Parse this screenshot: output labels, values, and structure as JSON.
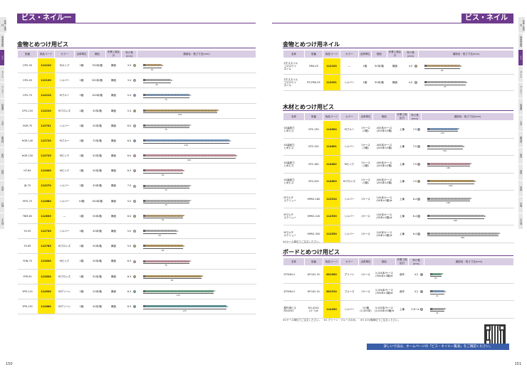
{
  "page": {
    "title_left": "ビス・ネイル一覧",
    "title_right": "ビス・ネイル一覧",
    "page_left": "150",
    "page_right": "151"
  },
  "side_tabs_left": [
    "合板・集成材",
    "構造用金物",
    "ビス",
    "ネイル",
    "アンカー",
    "接着剤",
    "工具",
    "副資材",
    "床材",
    "建材",
    "住設",
    "外構",
    "その他"
  ],
  "side_tabs_right": [
    "合板・集成材",
    "構造用金物",
    "ビス",
    "ネイル",
    "アンカー",
    "接着剤",
    "工具",
    "副資材",
    "床材",
    "建材",
    "住設",
    "外構",
    "その他"
  ],
  "sec_metal_bis": {
    "title": "金物とめつけ用ビス",
    "headers": [
      "型番",
      "商品コード",
      "カラー",
      "出荷単位",
      "梱包",
      "作業工程区分",
      "呼び長(mm)",
      "頭部径・長さ寸法(mm)"
    ],
    "rows": [
      {
        "model": "CPG-30",
        "code": "112220",
        "color": "Mカンプ",
        "unit": "1箱",
        "pack": "700本/箱",
        "process": "構造",
        "len": "3.5",
        "dim": "30",
        "screw_color": "#c9a874"
      },
      {
        "model": "CPG-45",
        "code": "112190",
        "color": "シルバー",
        "unit": "1箱",
        "pack": "500本/箱",
        "process": "構造",
        "len": "3.4",
        "dim": "45",
        "screw_color": "#bbbbbb"
      },
      {
        "model": "CPG-75",
        "code": "112210",
        "color": "Mブルー",
        "unit": "1箱",
        "pack": "100本/箱",
        "process": "構造",
        "len": "5.4",
        "dim": "75",
        "screw_color": "#8aa6c8"
      },
      {
        "model": "CPG-120",
        "code": "112220",
        "color": "Mブロンズ",
        "unit": "1箱",
        "pack": "50本/箱",
        "process": "構造",
        "len": "5.4",
        "dim": "120",
        "screw_color": "#c2a05a"
      },
      {
        "model": "HGR-75",
        "code": "112701",
        "color": "シルバー",
        "unit": "1箱",
        "pack": "50本/箱",
        "process": "構造",
        "len": "6.0",
        "dim": "75",
        "screw_color": "#c0c0c0"
      },
      {
        "model": "HGR-140",
        "code": "112720",
        "color": "Mブルー",
        "unit": "1箱",
        "pack": "70本/箱",
        "process": "構造",
        "len": "6.0",
        "dim": "140",
        "screw_color": "#7fa3cf"
      },
      {
        "model": "HGR-150",
        "code": "112725",
        "color": "Mピンク",
        "unit": "1箱",
        "pack": "50本/箱",
        "process": "構造",
        "len": "6.0",
        "dim": "150",
        "screw_color": "#d59aa7"
      },
      {
        "model": "HT-65",
        "code": "112600",
        "color": "Mピンク",
        "unit": "1箱",
        "pack": "50本/箱",
        "process": "構造",
        "len": "6.3",
        "dim": "65",
        "screw_color": "#d59aa7"
      },
      {
        "model": "JB-75",
        "code": "112270",
        "color": "シルバー",
        "unit": "1箱",
        "pack": "30本/箱",
        "process": "構造",
        "len": "7.0",
        "dim": "75",
        "screw_color": "#c0c0c0"
      },
      {
        "model": "MTS-75",
        "code": "112680",
        "color": "シルバー",
        "unit": "10箱",
        "pack": "150本/箱",
        "process": "構造",
        "len": "5.0",
        "dim": "75",
        "screw_color": "#c0c0c0"
      },
      {
        "model": "TBM-65",
        "code": "112635",
        "color": "―",
        "unit": "1箱",
        "pack": "50本/箱",
        "process": "構造",
        "len": "6.0",
        "dim": "65",
        "screw_color": "#c9a874"
      },
      {
        "model": "YS-55",
        "code": "112750",
        "color": "シルバー",
        "unit": "1箱",
        "pack": "50本/箱",
        "process": "構造",
        "len": "5.0",
        "dim": "55",
        "screw_color": "#c0c0c0"
      },
      {
        "model": "YS-65",
        "code": "112785",
        "color": "Mブロンズ",
        "unit": "1箱",
        "pack": "50本/箱",
        "process": "構造",
        "len": "5.5",
        "dim": "65",
        "screw_color": "#c2a05a"
      },
      {
        "model": "YHN-75",
        "code": "112640",
        "color": "Mピンク",
        "unit": "1箱",
        "pack": "50本/箱",
        "process": "構造",
        "len": "6.3",
        "dim": "75",
        "screw_color": "#d59aa7"
      },
      {
        "model": "YPR-95",
        "code": "112630",
        "color": "Mブロンズ",
        "unit": "1箱",
        "pack": "50本/箱",
        "process": "構造",
        "len": "6.3",
        "dim": "95",
        "screw_color": "#c2a05a"
      },
      {
        "model": "YPR-115",
        "code": "112630",
        "color": "Mグリーン",
        "unit": "1箱",
        "pack": "20本/箱",
        "process": "構造",
        "len": "6.3",
        "dim": "115",
        "screw_color": "#6fb28f"
      },
      {
        "model": "YPR-135",
        "code": "112660",
        "color": "Mグリーン",
        "unit": "1箱",
        "pack": "40本/箱",
        "process": "構造",
        "len": "6.3",
        "dim": "135",
        "screw_color": "#5da3a6"
      }
    ]
  },
  "sec_metal_nail": {
    "title": "金物とめつけ用ネイル",
    "headers": [
      "名称",
      "型番",
      "商品コード",
      "カラー",
      "出荷単位",
      "梱包",
      "作業工程区分",
      "呼び長(mm)",
      "頭部径・長さ寸法(mm)"
    ],
    "rows": [
      {
        "name": "Zホスネイル\nゴスロクイ\nネイル",
        "model": "FBN-55",
        "code": "112103",
        "color": "―",
        "unit": "1箱",
        "pack": "50本/箱",
        "process": "構造",
        "len": "4.5",
        "dim": "65",
        "screw_color": "#c9a874"
      },
      {
        "name": "Zホスネイル\nゴスロクイ\nネイル",
        "model": "PZ-FRN-55",
        "code": "112091",
        "color": "シルバー",
        "unit": "1箱",
        "pack": "50本/箱",
        "process": "構造",
        "len": "4.5",
        "dim": "75",
        "screw_color": "#bbbbbb"
      }
    ]
  },
  "sec_wood_bis": {
    "title": "木材とめつけ用ビス",
    "headers": [
      "名称",
      "型番",
      "商品コード",
      "カラー",
      "出荷単位",
      "梱包",
      "作業工程区分",
      "呼び長(mm)",
      "頭部径・長さ寸法(mm)"
    ],
    "rows": [
      {
        "name": "SX高耐力\nとめビス",
        "model": "KTS-130",
        "code": "114600",
        "color": "Mブルー",
        "unit": "1ケース\n(2箱)",
        "pack": "400本/ケース\n(200本×2箱)",
        "process": "上棟",
        "len": "7.0",
        "dim": "130",
        "screw_color": "#7fa3cf"
      },
      {
        "name": "SX高耐力\nとめビス",
        "model": "KTS-150",
        "code": "114601",
        "color": "シルバー",
        "unit": "1ケース\n(2箱)",
        "pack": "400本/ケース\n(200本×2箱)",
        "process": "上棟",
        "len": "7.0",
        "dim": "150",
        "screw_color": "#bbbbbb"
      },
      {
        "name": "SX高耐力\nとめビス",
        "model": "KTS-180",
        "code": "114602",
        "color": "Mピンク",
        "unit": "1ケース\n(2箱)",
        "pack": "400本/ケース\n(200本×2箱)",
        "process": "上棟",
        "len": "7.0",
        "dim": "180",
        "screw_color": "#d59aa7"
      },
      {
        "name": "SX高耐力\nとめビス",
        "model": "KTS-200",
        "code": "114603",
        "color": "Mブロンズ",
        "unit": "1ケース\n(2箱)",
        "pack": "400本/ケース\n(200本×2箱)",
        "process": "上棟",
        "len": "7.0",
        "dim": "200",
        "screw_color": "#c2a05a"
      },
      {
        "name": "Mマルチ\nスクリュー",
        "model": "MPKS-180",
        "code": "112510",
        "color": "シルバー",
        "unit": "1ケース",
        "pack": "100本/ケース\n(50本×2箱)※",
        "process": "上棟",
        "len": "6.4",
        "dim": "180",
        "screw_color": "#bbbbbb"
      },
      {
        "name": "Mマルチ\nスクリュー",
        "model": "MPKS-240",
        "code": "112530",
        "color": "シルバー",
        "unit": "1ケース",
        "pack": "100本/ケース\n(50本×2箱)※",
        "process": "上棟",
        "len": "6.4",
        "dim": "240",
        "screw_color": "#bbbbbb"
      },
      {
        "name": "Mマルチ\nスクリュー",
        "model": "MPKS-300",
        "code": "112550",
        "color": "シルバー",
        "unit": "1ケース",
        "pack": "100本/ケース\n(50本×2箱)※",
        "process": "上棟",
        "len": "6.4",
        "dim": "300",
        "screw_color": "#bbbbbb"
      }
    ],
    "footnote": "※1ケース単位でご注文ください。"
  },
  "sec_board_bis": {
    "title": "ボードとめつけ用ビス",
    "headers": [
      "名称",
      "型番",
      "商品コード",
      "カラー",
      "出荷単位",
      "梱包",
      "作業工程区分",
      "呼び長(mm)",
      "頭部径・長さ寸法(mm)"
    ],
    "rows": [
      {
        "name": "DTSHN-2",
        "model": "KFG42-32",
        "code": "801500",
        "color": "グリーン",
        "unit": "1ケース",
        "pack": "2,000本/ケース\n(500本×4箱)※",
        "process": "造作",
        "len": "4.2",
        "dim": "32",
        "screw_color": "#6fb28f"
      },
      {
        "name": "DTSHN-2",
        "model": "KFG42-41",
        "code": "801510",
        "color": "ブルーズ",
        "unit": "1ケース",
        "pack": "2,000本/ケース\n(500本×4箱)※",
        "process": "造作",
        "len": "4.2",
        "dim": "41",
        "screw_color": "#7fa3cf"
      },
      {
        "name": "屋外用ビス\nKG4041",
        "model": "KG-4041\n(ﾐﾄﾞﾘ)※",
        "code": "114450",
        "color": "シルバー",
        "unit": "1小箱\n(1,000本)",
        "pack": "5,000本/ケース\n(1,000本×5箱)※",
        "process": "上棟",
        "len": "3.8〜4.2",
        "dim": "41",
        "screw_color": "#bbbbbb"
      }
    ],
    "footnote": "※1ケース単位でご注文ください。　※2 グリーン・ブルーズのみ。　※3 10小箱単位でご注文ください。"
  },
  "banner": "詳しい寸法は、ホームページの「ビス・ネイル一覧表」をご確認ください。"
}
